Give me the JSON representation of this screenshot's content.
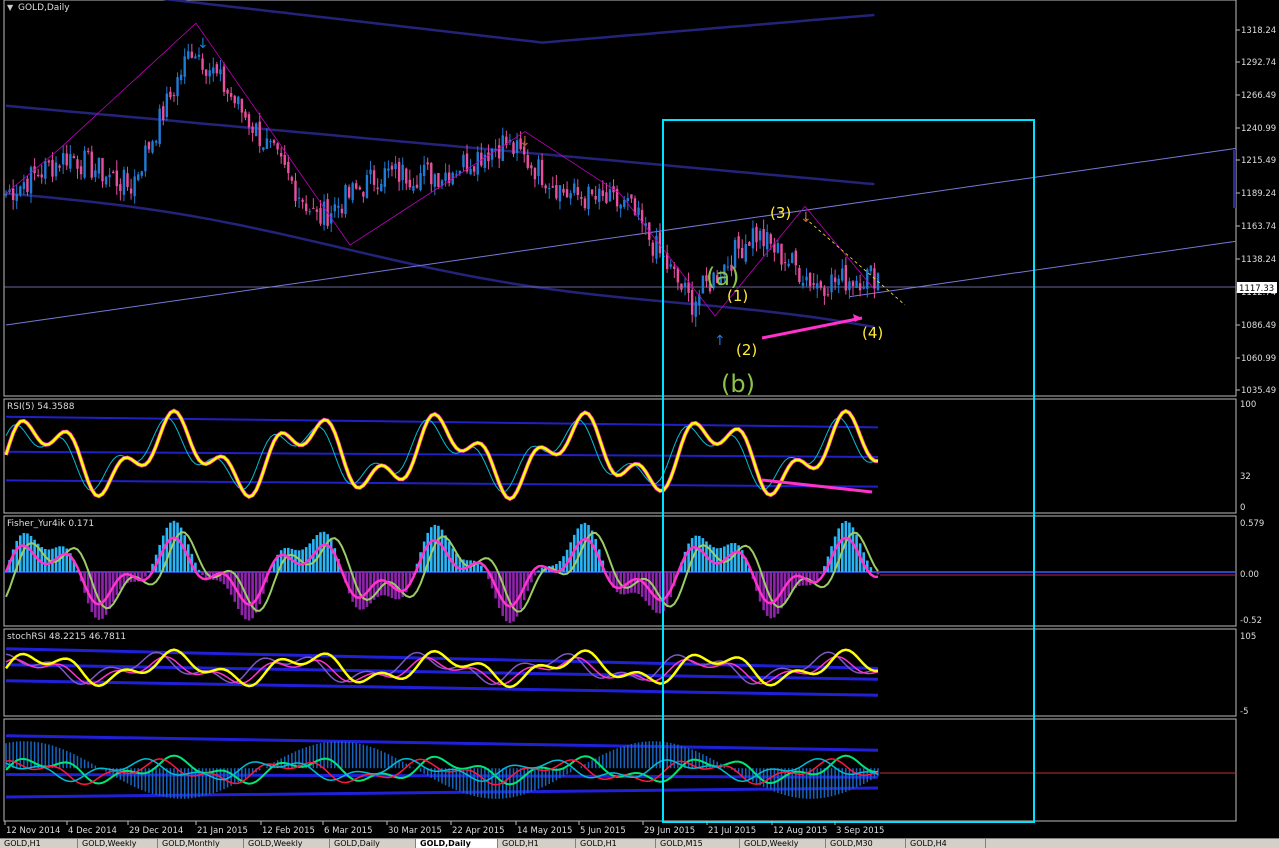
{
  "window": {
    "title": "GOLD,Daily"
  },
  "price_scale": [
    "1318.24",
    "1292.74",
    "1266.49",
    "1240.99",
    "1215.49",
    "1189.24",
    "1163.74",
    "1138.24",
    "1112.74",
    "1086.49",
    "1060.99",
    "1035.49"
  ],
  "current_price": "1117.33",
  "date_axis": [
    "12 Nov 2014",
    "4 Dec 2014",
    "29 Dec 2014",
    "21 Jan 2015",
    "12 Feb 2015",
    "6 Mar 2015",
    "30 Mar 2015",
    "22 Apr 2015",
    "14 May 2015",
    "5 Jun 2015",
    "29 Jun 2015",
    "21 Jul 2015",
    "12 Aug 2015",
    "3 Sep 2015"
  ],
  "wave_labels": [
    "(a)",
    "(b)",
    "(1)",
    "(2)",
    "(3)",
    "(4)"
  ],
  "panels": {
    "rsi": {
      "label": "RSI(5) 54.3588",
      "scale": [
        "100",
        "32",
        "0"
      ]
    },
    "fisher": {
      "label": "Fisher_Yur4ik 0.171",
      "scale": [
        "0.579",
        "0.00",
        "-0.52"
      ]
    },
    "stochrsi": {
      "label": "stochRSI 48.2215 46.7811",
      "scale": [
        "105",
        "-5"
      ]
    }
  },
  "tabs": [
    "GOLD,H1",
    "GOLD,Weekly",
    "GOLD,Monthly",
    "GOLD,Weekly",
    "GOLD,Daily",
    "GOLD,Daily",
    "GOLD,H1",
    "GOLD,H1",
    "GOLD,M15",
    "GOLD,Weekly",
    "GOLD,M30",
    "GOLD,H4"
  ],
  "active_tab_index": 5,
  "colors": {
    "bull": "#1f7bd6",
    "bear": "#e8509f",
    "selection": "#00e5ff",
    "wave_yellow": "#ffeb3b",
    "wave_green": "#8bc34a",
    "envelope": "#23237a",
    "trendline": "#7878d8",
    "rsi_line": "#ffff00",
    "magenta": "#ff00ff"
  },
  "chart_data": [
    {
      "type": "candlestick",
      "title": "GOLD,Daily",
      "y_range": [
        1023,
        1330
      ],
      "x": [
        "12 Nov 2014",
        "4 Dec 2014",
        "29 Dec 2014",
        "21 Jan 2015",
        "12 Feb 2015",
        "6 Mar 2015",
        "30 Mar 2015",
        "22 Apr 2015",
        "14 May 2015",
        "5 Jun 2015",
        "29 Jun 2015",
        "21 Jul 2015",
        "12 Aug 2015",
        "3 Sep 2015",
        "16 Sep 2015"
      ],
      "close": [
        1180,
        1210,
        1185,
        1295,
        1230,
        1160,
        1195,
        1195,
        1220,
        1180,
        1170,
        1095,
        1150,
        1110,
        1117.33
      ],
      "wave_labels": [
        {
          "label": "(a)",
          "date": "17 Jul 2015",
          "price": 1130
        },
        {
          "label": "(b)",
          "date": "27 Jul 2015",
          "price": 1038
        },
        {
          "label": "(1)",
          "date": "24 Jul 2015",
          "price": 1112
        },
        {
          "label": "(2)",
          "date": "27 Jul 2015",
          "price": 1076
        },
        {
          "label": "(3)",
          "date": "19 Aug 2015",
          "price": 1170
        },
        {
          "label": "(4)",
          "date": "11 Sep 2015",
          "price": 1081
        }
      ]
    },
    {
      "type": "line",
      "title": "RSI(5) 54.3588",
      "ylim": [
        0,
        100
      ],
      "series": [
        {
          "name": "RSI(5)",
          "last": 54.3588
        }
      ]
    },
    {
      "type": "bar",
      "title": "Fisher_Yur4ik 0.171",
      "ylim": [
        -0.52,
        0.579
      ],
      "series": [
        {
          "name": "Fisher_Yur4ik",
          "last": 0.171
        }
      ]
    },
    {
      "type": "line",
      "title": "stochRSI 48.2215 46.7811",
      "ylim": [
        -5,
        105
      ],
      "series": [
        {
          "name": "stochRSI main",
          "last": 48.2215
        },
        {
          "name": "stochRSI signal",
          "last": 46.7811
        }
      ]
    }
  ]
}
